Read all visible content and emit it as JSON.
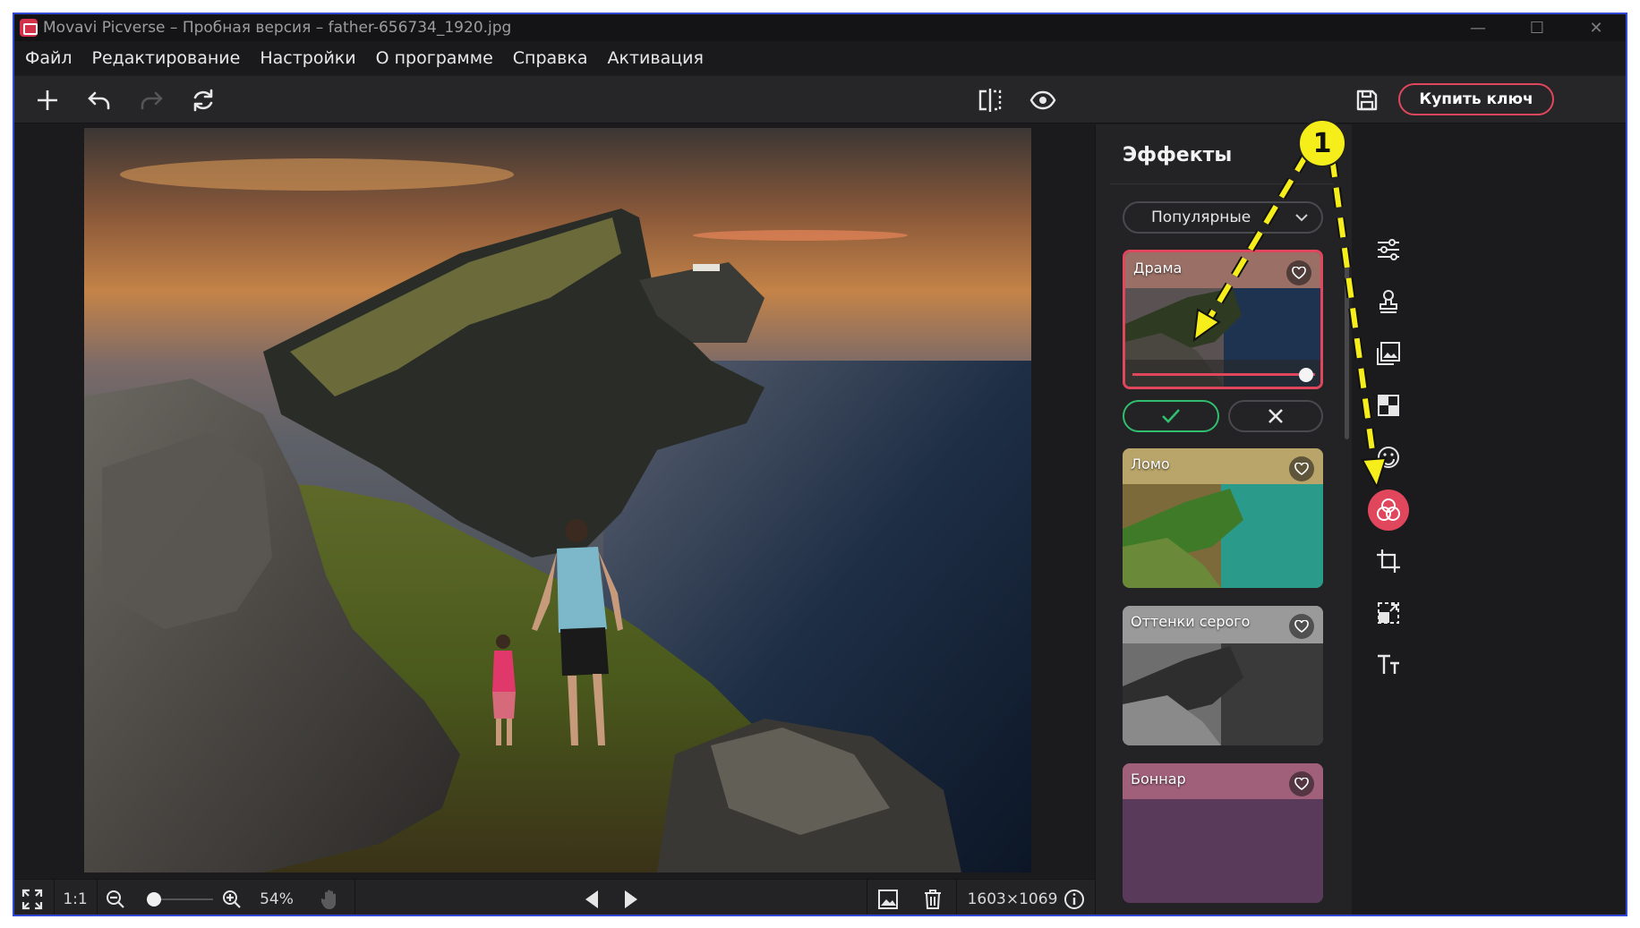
{
  "window": {
    "title": "Movavi Picverse – Пробная версия – father-656734_1920.jpg",
    "controls": [
      "minimize-icon",
      "maximize-icon",
      "close-icon"
    ]
  },
  "menu": {
    "items": [
      "Файл",
      "Редактирование",
      "Настройки",
      "О программе",
      "Справка",
      "Активация"
    ]
  },
  "toolbar": {
    "left_icons": [
      "add-icon",
      "undo-icon",
      "redo-icon",
      "reset-icon"
    ],
    "center_icons": [
      "compare-icon",
      "preview-eye-icon"
    ],
    "buy_label": "Купить ключ",
    "save_icon": "save-icon",
    "accent": "#e0475d"
  },
  "effects_panel": {
    "title": "Эффекты",
    "category": "Популярные",
    "effects": [
      {
        "name": "Драма",
        "active": true,
        "intensity": 1.0
      },
      {
        "name": "Ломо",
        "active": false
      },
      {
        "name": "Оттенки серого",
        "active": false
      },
      {
        "name": "Боннар",
        "active": false
      }
    ],
    "apply_color": "#2fbf6e"
  },
  "rail": {
    "tools": [
      "adjust-sliders-icon",
      "stamp-icon",
      "image-replace-icon",
      "background-icon",
      "face-retouch-icon",
      "effects-icon",
      "crop-icon",
      "resize-icon",
      "text-icon"
    ],
    "active_tool": "effects-icon"
  },
  "bottom_bar": {
    "fit_icon": "fit-screen-icon",
    "actual_size": "1:1",
    "zoom": "54%",
    "image_size": "1603×1069",
    "icons": [
      "zoom-out-icon",
      "zoom-in-icon",
      "hand-icon",
      "prev-icon",
      "next-icon",
      "image-icon",
      "trash-icon",
      "info-icon"
    ]
  },
  "annotation": {
    "badge": "1",
    "color": "#f6ee1b"
  }
}
